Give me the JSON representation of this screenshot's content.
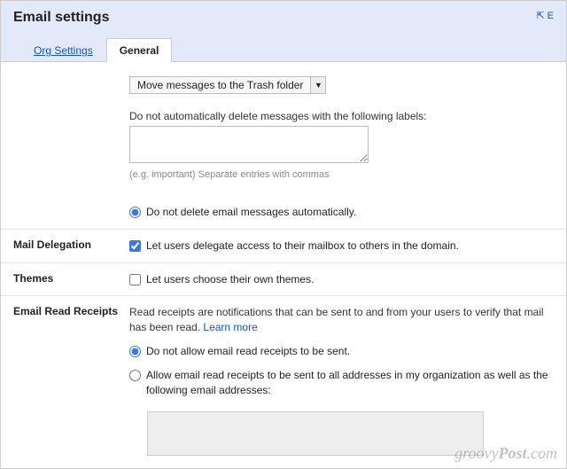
{
  "header": {
    "title": "Email settings",
    "expand": "E"
  },
  "tabs": {
    "org": "Org Settings",
    "general": "General"
  },
  "autoDelete": {
    "selectLabel": "Move messages to the Trash folder",
    "labelsPrompt": "Do not automatically delete messages with the following labels:",
    "hint": "(e.g. important) Separate entries with commas",
    "radio_noDelete": "Do not delete email messages automatically."
  },
  "delegation": {
    "label": "Mail Delegation",
    "check": "Let users delegate access to their mailbox to others in the domain."
  },
  "themes": {
    "label": "Themes",
    "check": "Let users choose their own themes."
  },
  "receipts": {
    "label": "Email Read Receipts",
    "desc": "Read receipts are notifications that can be sent to and from your users to verify that mail has been read.",
    "learn": "Learn more",
    "opt_none": "Do not allow email read receipts to be sent.",
    "opt_all": "Allow email read receipts to be sent to all addresses in my organization as well as the following email addresses:"
  },
  "watermark": {
    "a": "groovy",
    "b": "Post",
    "c": ".com"
  }
}
